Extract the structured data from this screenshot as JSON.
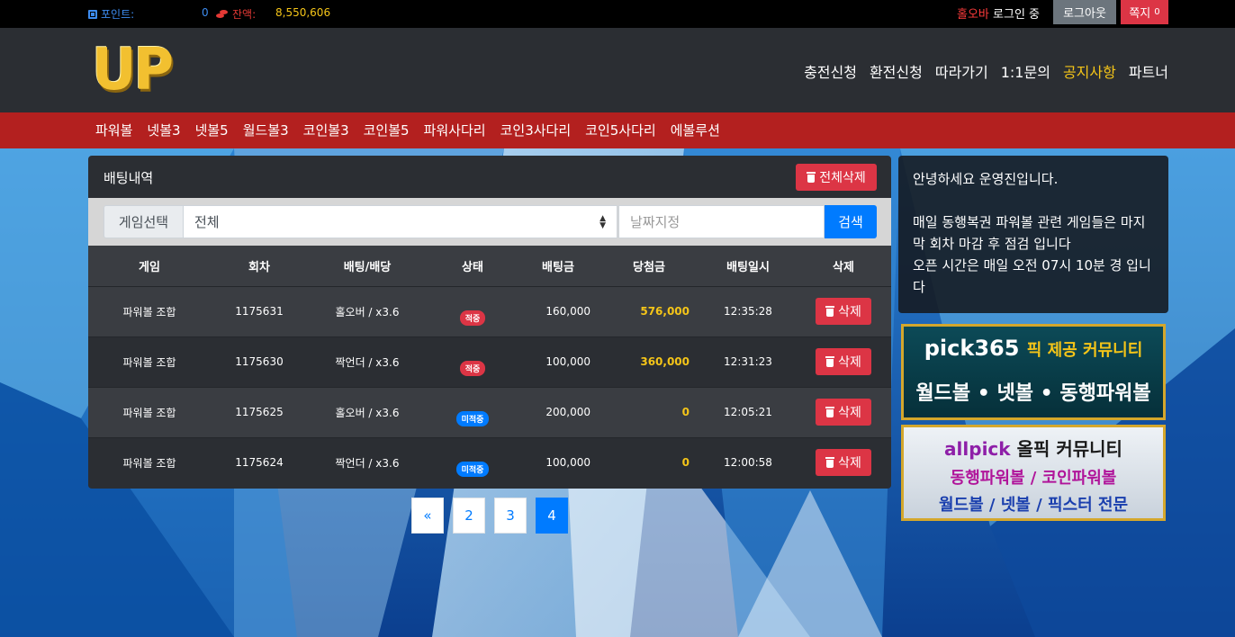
{
  "topbar": {
    "points_label": "포인트:",
    "points_value": "0",
    "balance_label": "잔액:",
    "balance_value": "8,550,606",
    "username": "홀오바",
    "login_status": "로그인 중",
    "logout_label": "로그아웃",
    "message_label": "쪽지",
    "message_count": "0"
  },
  "header": {
    "logo_text": "UP",
    "nav": [
      {
        "label": "충전신청"
      },
      {
        "label": "환전신청"
      },
      {
        "label": "따라가기"
      },
      {
        "label": "1:1문의"
      },
      {
        "label": "공지사항"
      },
      {
        "label": "파트너"
      }
    ]
  },
  "subnav": [
    {
      "label": "파워볼"
    },
    {
      "label": "넷볼3"
    },
    {
      "label": "넷볼5"
    },
    {
      "label": "월드볼3"
    },
    {
      "label": "코인볼3"
    },
    {
      "label": "코인볼5"
    },
    {
      "label": "파워사다리"
    },
    {
      "label": "코인3사다리"
    },
    {
      "label": "코인5사다리"
    },
    {
      "label": "에볼루션"
    }
  ],
  "bet_panel": {
    "title": "배팅내역",
    "delete_all_label": "전체삭제",
    "filter": {
      "game_select_label": "게임선택",
      "game_select_value": "전체",
      "date_placeholder": "날짜지정",
      "search_label": "검색"
    },
    "columns": [
      "게임",
      "회차",
      "배팅/배당",
      "상태",
      "배팅금",
      "당첨금",
      "배팅일시",
      "삭제"
    ],
    "rows": [
      {
        "game": "파워볼 조합",
        "round": "1175631",
        "bet": "홀오버 / x3.6",
        "status": "적중",
        "status_type": "hit",
        "amount": "160,000",
        "win": "576,000",
        "time": "12:35:28",
        "delete": "삭제"
      },
      {
        "game": "파워볼 조합",
        "round": "1175630",
        "bet": "짝언더 / x3.6",
        "status": "적중",
        "status_type": "hit",
        "amount": "100,000",
        "win": "360,000",
        "time": "12:31:23",
        "delete": "삭제"
      },
      {
        "game": "파워볼 조합",
        "round": "1175625",
        "bet": "홀오버 / x3.6",
        "status": "미적중",
        "status_type": "miss",
        "amount": "200,000",
        "win": "0",
        "time": "12:05:21",
        "delete": "삭제"
      },
      {
        "game": "파워볼 조합",
        "round": "1175624",
        "bet": "짝언더 / x3.6",
        "status": "미적중",
        "status_type": "miss",
        "amount": "100,000",
        "win": "0",
        "time": "12:00:58",
        "delete": "삭제"
      }
    ]
  },
  "pagination": {
    "prev": "«",
    "pages": [
      "2",
      "3",
      "4"
    ],
    "current": "4"
  },
  "notice": {
    "greeting": "안녕하세요 운영진입니다.",
    "body": "매일 동행복권 파워볼 관련 게임들은 마지막 회차 마감 후 점검 입니다\n오픈 시간은 매일 오전 07시 10분 경 입니다"
  },
  "banners": {
    "banner1": {
      "brand": "pick365",
      "tagline": "픽 제공 커뮤니티",
      "line2": "월드볼 • 넷볼 • 동행파워볼"
    },
    "banner2": {
      "brand": "allpick",
      "tagline": "올픽 커뮤니티",
      "line2": "동행파워볼 / 코인파워볼",
      "line3": "월드볼 / 넷볼 / 픽스터 전문"
    }
  },
  "colors": {
    "accent_yellow": "#f5c518",
    "danger_red": "#dc3545",
    "primary_blue": "#007bff",
    "subnav_red": "#b3201f",
    "header_dark": "#2b2e33"
  }
}
